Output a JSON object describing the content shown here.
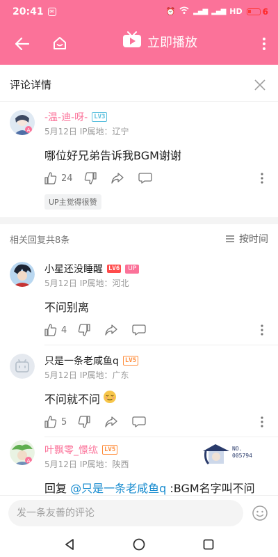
{
  "status_bar": {
    "time": "20:41",
    "battery": "6",
    "network_label": "HD"
  },
  "nav": {
    "play_label": "立即播放"
  },
  "header": {
    "title": "评论详情"
  },
  "main_comment": {
    "user": "-温-迪-呀-",
    "level": "LV3",
    "date": "5月12日",
    "ip": "IP属地：辽宁",
    "text": "哪位好兄弟告诉我BGM谢谢",
    "likes": "24",
    "up_liked": "UP主觉得很赞"
  },
  "replies_header": {
    "count_label": "相关回复共8条",
    "sort_label": "按时间"
  },
  "replies": [
    {
      "user": "小星还没睡醒",
      "level": "LV6",
      "badge": "UP",
      "date": "5月12日",
      "ip": "IP属地：河北",
      "text": "不问别离",
      "likes": "4"
    },
    {
      "user": "只是一条老咸鱼q",
      "level": "LV5",
      "date": "5月12日",
      "ip": "IP属地：广东",
      "text": "不问就不问",
      "likes": "5"
    },
    {
      "user": "叶飘零_憬纮",
      "level": "LV5",
      "date": "5月12日",
      "ip": "IP属地：陕西",
      "reply_prefix": "回复 ",
      "mention": "@只是一条老咸鱼q",
      "text_suffix": " :BGM名字叫不问",
      "card_text": "NO.\n005794"
    }
  ],
  "input": {
    "placeholder": "发一条友善的评论"
  },
  "colors": {
    "brand": "#fb7299",
    "link": "#178bcf",
    "lv3": "#5bc0de",
    "lv5": "#ff8c3a",
    "lv6": "#ff4b4b"
  }
}
